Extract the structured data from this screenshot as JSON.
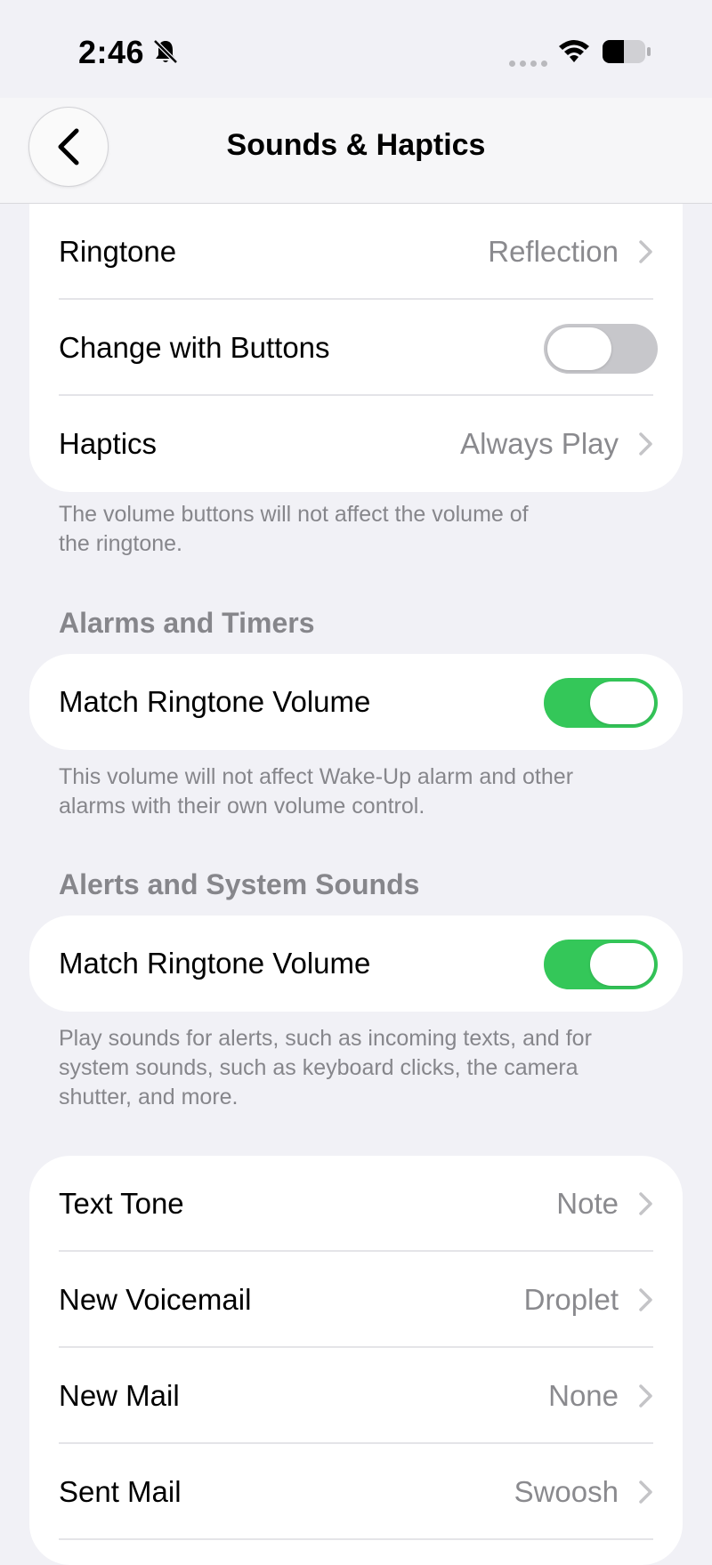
{
  "status_bar": {
    "time": "2:46"
  },
  "nav": {
    "title": "Sounds & Haptics"
  },
  "ringer_group": {
    "ringtone_label": "Ringtone",
    "ringtone_value": "Reflection",
    "change_with_buttons_label": "Change with Buttons",
    "change_with_buttons_on": false,
    "haptics_label": "Haptics",
    "haptics_value": "Always Play",
    "footnote_line1": "The volume buttons will not affect the volume of",
    "footnote_line2": "the ringtone."
  },
  "alarms": {
    "header": "Alarms and Timers",
    "match_label": "Match Ringtone Volume",
    "match_on": true,
    "footnote_line1": "This volume will not affect Wake-Up alarm and other",
    "footnote_line2": "alarms with their own volume control."
  },
  "alerts": {
    "header": "Alerts and System Sounds",
    "match_label": "Match Ringtone Volume",
    "match_on": true,
    "footnote_line1": "Play sounds for alerts, such as incoming texts, and for",
    "footnote_line2": "system sounds, such as keyboard clicks, the camera",
    "footnote_line3": "shutter, and more."
  },
  "tones": [
    {
      "label": "Text Tone",
      "value": "Note"
    },
    {
      "label": "New Voicemail",
      "value": "Droplet"
    },
    {
      "label": "New Mail",
      "value": "None"
    },
    {
      "label": "Sent Mail",
      "value": "Swoosh"
    }
  ],
  "colors": {
    "toggle_on": "#34c759",
    "toggle_off": "#c7c7cb",
    "background": "#f1f1f6"
  },
  "icons": [
    "bell-slash-icon",
    "wifi-icon",
    "battery-icon",
    "back-chevron-icon",
    "chevron-right-icon"
  ]
}
